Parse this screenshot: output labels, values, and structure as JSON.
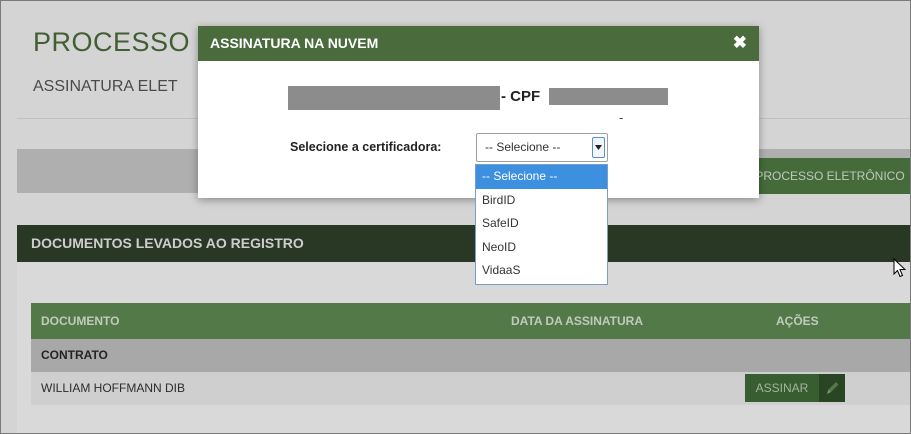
{
  "page": {
    "title": "PROCESSO",
    "subtitle": "ASSINATURA ELET",
    "processo_button": "PROCESSO ELETRÔNICO"
  },
  "documents": {
    "title": "DOCUMENTOS LEVADOS AO REGISTRO",
    "columns": [
      "DOCUMENTO",
      "DATA DA ASSINATURA",
      "AÇÕES"
    ],
    "group": "CONTRATO",
    "rows": [
      {
        "name": "WILLIAM HOFFMANN DIB",
        "action_label": "ASSINAR"
      }
    ]
  },
  "modal": {
    "title": "ASSINATURA NA NUVEM",
    "close_symbol": "✖",
    "cpf_label": "- CPF",
    "dash": "-",
    "select_label": "Selecione a certificadora:",
    "select_value": "-- Selecione --",
    "options": [
      "-- Selecione --",
      "BirdID",
      "SafeID",
      "NeoID",
      "VidaaS"
    ]
  },
  "colors": {
    "header_green": "#4a6b3c",
    "section_dark": "#2f3f2b",
    "table_head": "#5f8a53",
    "highlight_blue": "#3d8fe0"
  }
}
